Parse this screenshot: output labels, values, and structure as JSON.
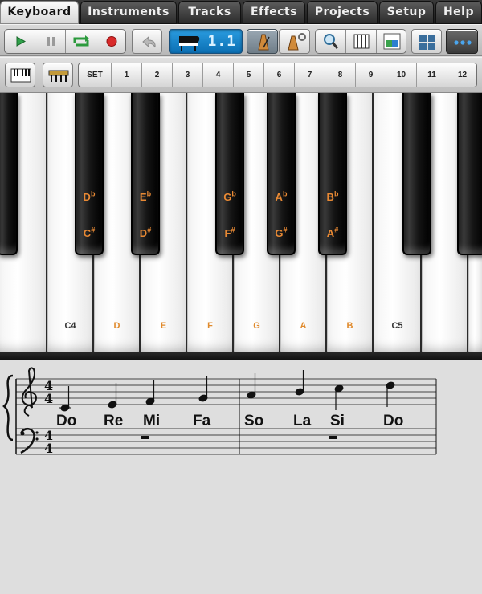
{
  "tabs": [
    {
      "label": "Keyboard",
      "active": true
    },
    {
      "label": "Instruments",
      "active": false
    },
    {
      "label": "Tracks",
      "active": false
    },
    {
      "label": "Effects",
      "active": false
    },
    {
      "label": "Projects",
      "active": false
    },
    {
      "label": "Setup",
      "active": false
    },
    {
      "label": "Help",
      "active": false
    }
  ],
  "transport": {
    "play_icon": "play-icon",
    "pause_icon": "pause-icon",
    "loop_icon": "loop-icon",
    "record_icon": "record-icon",
    "undo_icon": "undo-icon",
    "lcd_value": "1.1",
    "lcd_icon": "grand-piano-icon"
  },
  "toolbar_icons": [
    "metronome-icon",
    "metronome-settings-icon",
    "zoom-icon",
    "mixer-icon",
    "chord-icon",
    "layout-icon",
    "more-icon"
  ],
  "presets": {
    "set_label": "SET",
    "numbers": [
      "1",
      "2",
      "3",
      "4",
      "5",
      "6",
      "7",
      "8",
      "9",
      "10",
      "11",
      "12"
    ]
  },
  "white_keys": [
    "",
    "C4",
    "D",
    "E",
    "F",
    "G",
    "A",
    "B",
    "C5",
    "",
    ""
  ],
  "black_keys": [
    {
      "flat": "",
      "sharp": ""
    },
    {
      "flat": "D",
      "sharp": "C"
    },
    {
      "flat": "E",
      "sharp": "D"
    },
    {
      "flat": "G",
      "sharp": "F"
    },
    {
      "flat": "A",
      "sharp": "G"
    },
    {
      "flat": "B",
      "sharp": "A"
    },
    {
      "flat": "",
      "sharp": ""
    },
    {
      "flat": "",
      "sharp": ""
    }
  ],
  "accidental_flat": "b",
  "accidental_sharp": "#",
  "score": {
    "time_signature": [
      "4",
      "4"
    ],
    "solfege": [
      "Do",
      "Re",
      "Mi",
      "Fa",
      "So",
      "La",
      "Si",
      "Do"
    ]
  },
  "colors": {
    "note_label": "#e08a2c",
    "lcd": "#1b86cc"
  }
}
